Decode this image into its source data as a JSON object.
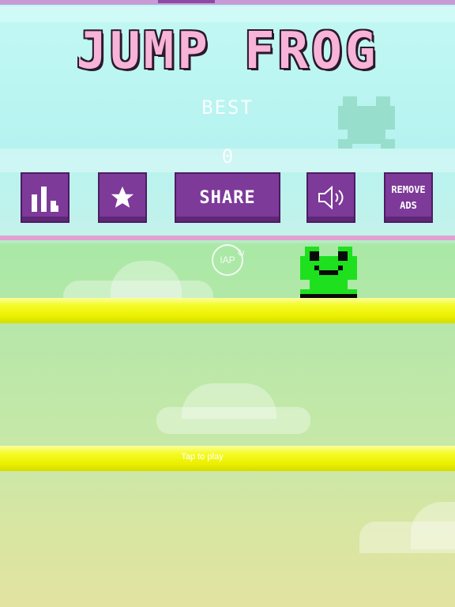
{
  "game": {
    "title": "JUMP FROG",
    "best_label": "BEST",
    "best_value": "0",
    "hint": "Tap to play"
  },
  "buttons": {
    "leaderboard_icon": "bar-chart-icon",
    "rate_icon": "star-icon",
    "share_label": "SHARE",
    "sound_icon": "speaker-icon",
    "remove_ads_line1": "REMOVE",
    "remove_ads_line2": "ADS",
    "iap_label": "IAP"
  },
  "colors": {
    "button": "#7d3a99",
    "title": "#f7b3d8",
    "frog": "#1ee01e",
    "platform": "#f5fb27"
  }
}
